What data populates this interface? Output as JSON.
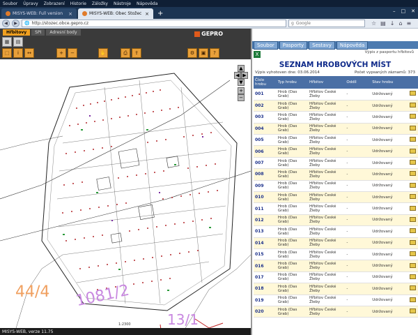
{
  "browser": {
    "menu": [
      "Soubor",
      "Úpravy",
      "Zobrazení",
      "Historie",
      "Záložky",
      "Nástroje",
      "Nápověda"
    ],
    "tabs": [
      {
        "label": "MISYS-WEB: Full version"
      },
      {
        "label": "MISYS-WEB: Obec Stožec"
      }
    ],
    "url": "http://stozec.obce.gepro.cz",
    "search_placeholder": "Google"
  },
  "map": {
    "tabs": [
      "Hřbitovy",
      "SPI",
      "Adresní body"
    ],
    "brand": "GEPRO",
    "status": "MISYS-WEB, verze 11.75",
    "scale": "1:2300",
    "parcel_labels": [
      "44/4",
      "1081/2",
      "13/1"
    ]
  },
  "panel": {
    "menu": [
      "Soubor",
      "Pasporty",
      "Sestavy",
      "Nápověda"
    ],
    "export_link": "Výpis z pasportu hřbitovů",
    "title": "SEZNAM HROBOVÝCH MÍST",
    "generated": "Výpis vyhotoven dne: 03.06.2014",
    "count": "Počet vypsaných záznamů: 373",
    "columns": [
      "Číslo hrobu",
      "Typ hrobu",
      "Hřbitov",
      "Oddíl",
      "Stav hrobu"
    ],
    "rows": [
      {
        "num": "001",
        "type": "Hrob (Das Grab)",
        "cemetery": "Hřbitov České Žleby",
        "section": "-",
        "state": "Udržovaný"
      },
      {
        "num": "002",
        "type": "Hrob (Das Grab)",
        "cemetery": "Hřbitov České Žleby",
        "section": "-",
        "state": "Udržovaný"
      },
      {
        "num": "003",
        "type": "Hrob (Das Grab)",
        "cemetery": "Hřbitov České Žleby",
        "section": "-",
        "state": "Udržovaný"
      },
      {
        "num": "004",
        "type": "Hrob (Das Grab)",
        "cemetery": "Hřbitov České Žleby",
        "section": "-",
        "state": "Udržovaný"
      },
      {
        "num": "005",
        "type": "Hrob (Das Grab)",
        "cemetery": "Hřbitov České Žleby",
        "section": "-",
        "state": "Udržovaný"
      },
      {
        "num": "006",
        "type": "Hrob (Das Grab)",
        "cemetery": "Hřbitov České Žleby",
        "section": "-",
        "state": "Udržovaný"
      },
      {
        "num": "007",
        "type": "Hrob (Das Grab)",
        "cemetery": "Hřbitov České Žleby",
        "section": "-",
        "state": "Udržovaný"
      },
      {
        "num": "008",
        "type": "Hrob (Das Grab)",
        "cemetery": "Hřbitov České Žleby",
        "section": "-",
        "state": "Udržovaný"
      },
      {
        "num": "009",
        "type": "Hrob (Das Grab)",
        "cemetery": "Hřbitov České Žleby",
        "section": "-",
        "state": "Udržovaný"
      },
      {
        "num": "010",
        "type": "Hrob (Das Grab)",
        "cemetery": "Hřbitov České Žleby",
        "section": "-",
        "state": "Udržovaný"
      },
      {
        "num": "011",
        "type": "Hrob (Das Grab)",
        "cemetery": "Hřbitov České Žleby",
        "section": "-",
        "state": "Udržovaný"
      },
      {
        "num": "012",
        "type": "Hrob (Das Grab)",
        "cemetery": "Hřbitov České Žleby",
        "section": "-",
        "state": "Udržovaný"
      },
      {
        "num": "013",
        "type": "Hrob (Das Grab)",
        "cemetery": "Hřbitov České Žleby",
        "section": "-",
        "state": "Udržovaný"
      },
      {
        "num": "014",
        "type": "Hrob (Das Grab)",
        "cemetery": "Hřbitov České Žleby",
        "section": "-",
        "state": "Udržovaný"
      },
      {
        "num": "015",
        "type": "Hrob (Das Grab)",
        "cemetery": "Hřbitov České Žleby",
        "section": "-",
        "state": "Udržovaný"
      },
      {
        "num": "016",
        "type": "Hrob (Das Grab)",
        "cemetery": "Hřbitov České Žleby",
        "section": "-",
        "state": "Udržovaný"
      },
      {
        "num": "017",
        "type": "Hrob (Das Grab)",
        "cemetery": "Hřbitov České Žleby",
        "section": "-",
        "state": "Udržovaný"
      },
      {
        "num": "018",
        "type": "Hrob (Das Grab)",
        "cemetery": "Hřbitov České Žleby",
        "section": "-",
        "state": "Udržovaný"
      },
      {
        "num": "019",
        "type": "Hrob (Das Grab)",
        "cemetery": "Hřbitov České Žleby",
        "section": "-",
        "state": "Udržovaný"
      },
      {
        "num": "020",
        "type": "Hrob (Das Grab)",
        "cemetery": "Hřbitov České Žleby",
        "section": "-",
        "state": "Udržovaný"
      }
    ]
  }
}
